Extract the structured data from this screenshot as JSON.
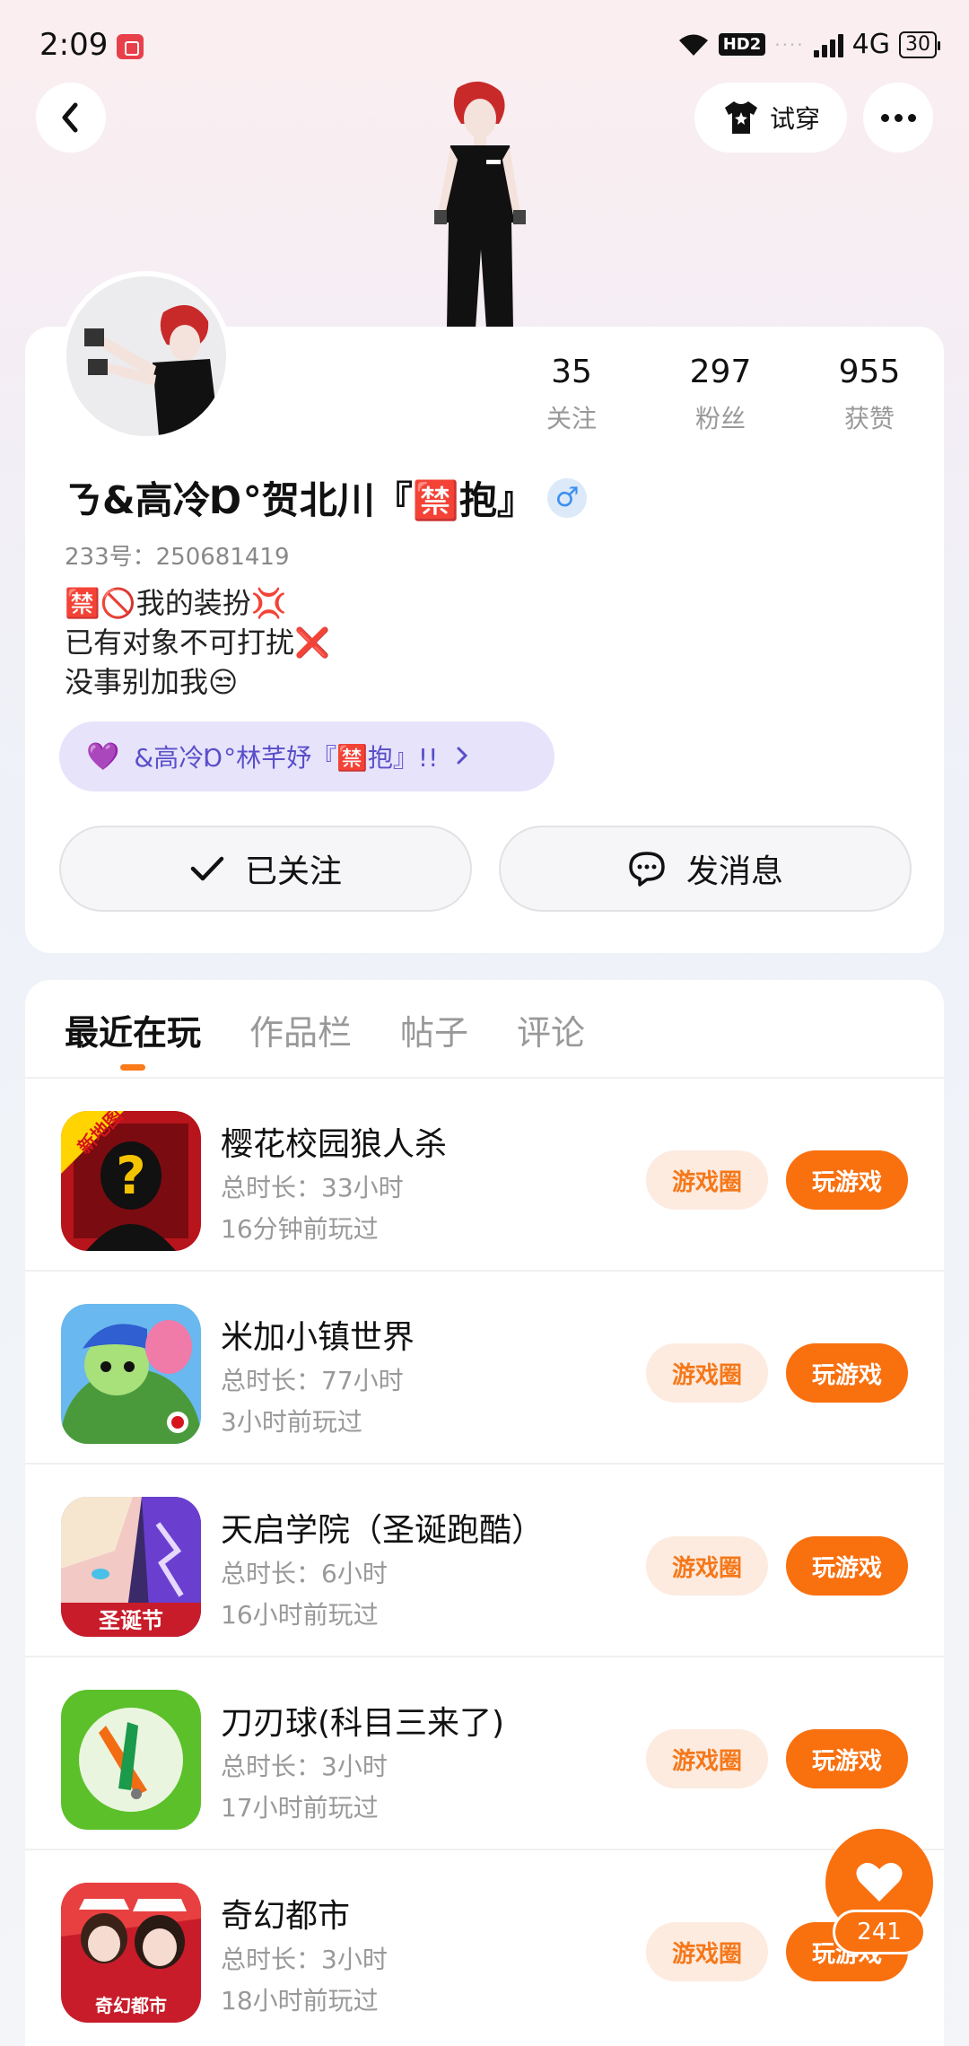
{
  "status_bar": {
    "time": "2:09",
    "hd": "HD2",
    "network": "4G",
    "battery": "30"
  },
  "nav": {
    "tryon_label": "试穿"
  },
  "profile": {
    "stats": [
      {
        "value": "35",
        "label": "关注"
      },
      {
        "value": "297",
        "label": "粉丝"
      },
      {
        "value": "955",
        "label": "获赞"
      }
    ],
    "username": "ㄋ&高冷Ɒ°贺北川『🈲抱』",
    "gender": "♂",
    "uid": "233号：250681419",
    "bio": [
      "🈲🚫我的装扮💢",
      "已有对象不可打扰❌",
      "没事别加我😒"
    ],
    "couple_tag": "&高冷Ɒ°林芊妤『🈲抱』!!",
    "follow_label": "已关注",
    "message_label": "发消息"
  },
  "tabs": [
    "最近在玩",
    "作品栏",
    "帖子",
    "评论"
  ],
  "games": [
    {
      "name": "樱花校园狼人杀",
      "total": "总时长：33小时",
      "last": "16分钟前玩过",
      "circle": "游戏圈",
      "play": "玩游戏",
      "badge": "新地图"
    },
    {
      "name": "米加小镇世界",
      "total": "总时长：77小时",
      "last": "3小时前玩过",
      "circle": "游戏圈",
      "play": "玩游戏"
    },
    {
      "name": "天启学院（圣诞跑酷）",
      "total": "总时长：6小时",
      "last": "16小时前玩过",
      "circle": "游戏圈",
      "play": "玩游戏",
      "badge": "圣诞节"
    },
    {
      "name": "刀刃球(科目三来了)",
      "total": "总时长：3小时",
      "last": "17小时前玩过",
      "circle": "游戏圈",
      "play": "玩游戏"
    },
    {
      "name": "奇幻都市",
      "total": "总时长：3小时",
      "last": "18小时前玩过",
      "circle": "游戏圈",
      "play": "玩游戏",
      "badge": "奇幻都市"
    }
  ],
  "like_count": "241",
  "colors": {
    "accent": "#f9700f",
    "accent_light": "#fdebe0",
    "couple_bg": "#e7e3fb",
    "gender": "#3d8ff0"
  }
}
